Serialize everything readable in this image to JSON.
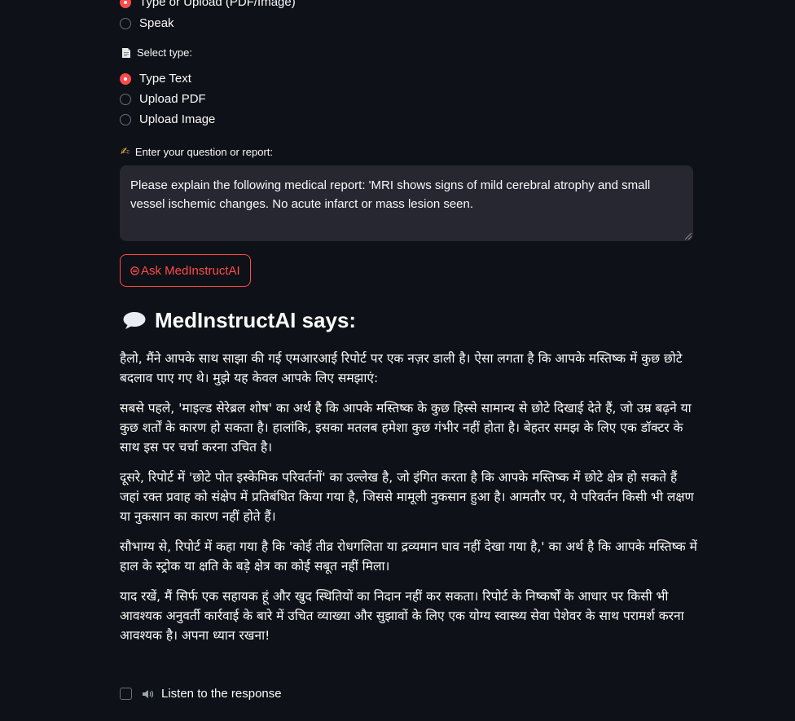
{
  "input_mode": {
    "options": [
      {
        "label": "Type or Upload (PDF/Image)",
        "selected": true
      },
      {
        "label": "Speak",
        "selected": false
      }
    ]
  },
  "select_type": {
    "icon": "document-icon",
    "label": "Select type:",
    "options": [
      {
        "label": "Type Text",
        "selected": true
      },
      {
        "label": "Upload PDF",
        "selected": false
      },
      {
        "label": "Upload Image",
        "selected": false
      }
    ]
  },
  "question": {
    "icon": "writing-hand-icon",
    "label": "Enter your question or report:",
    "value": "Please explain the following medical report: 'MRI shows signs of mild cerebral atrophy and small vessel ischemic changes. No acute infarct or mass lesion seen."
  },
  "ask_button": {
    "icon": "stethoscope-icon",
    "label": "Ask MedInstructAI"
  },
  "response": {
    "icon": "speech-bubble-icon",
    "heading": "MedInstructAI says:",
    "paragraphs": [
      "हैलो, मैंने आपके साथ साझा की गई एमआरआई रिपोर्ट पर एक नज़र डाली है। ऐसा लगता है कि आपके मस्तिष्क में कुछ छोटे बदलाव पाए गए थे। मुझे यह केवल आपके लिए समझाएं:",
      "सबसे पहले, 'माइल्ड सेरेब्रल शोष' का अर्थ है कि आपके मस्तिष्क के कुछ हिस्से सामान्य से छोटे दिखाई देते हैं, जो उम्र बढ़ने या कुछ शर्तों के कारण हो सकता है। हालांकि, इसका मतलब हमेशा कुछ गंभीर नहीं होता है। बेहतर समझ के लिए एक डॉक्टर के साथ इस पर चर्चा करना उचित है।",
      "दूसरे, रिपोर्ट में 'छोटे पोत इस्केमिक परिवर्तनों' का उल्लेख है, जो इंगित करता है कि आपके मस्तिष्क में छोटे क्षेत्र हो सकते हैं जहां रक्त प्रवाह को संक्षेप में प्रतिबंधित किया गया है, जिससे मामूली नुकसान हुआ है। आमतौर पर, ये परिवर्तन किसी भी लक्षण या नुकसान का कारण नहीं होते हैं।",
      "सौभाग्य से, रिपोर्ट में कहा गया है कि 'कोई तीव्र रोधगलिता या द्रव्यमान घाव नहीं देखा गया है,' का अर्थ है कि आपके मस्तिष्क में हाल के स्ट्रोक या क्षति के बड़े क्षेत्र का कोई सबूत नहीं मिला।",
      "याद रखें, मैं सिर्फ एक सहायक हूं और खुद स्थितियों का निदान नहीं कर सकता। रिपोर्ट के निष्कर्षों के आधार पर किसी भी आवश्यक अनुवर्ती कार्रवाई के बारे में उचित व्याख्या और सुझावों के लिए एक योग्य स्वास्थ्य सेवा पेशेवर के साथ परामर्श करना आवश्यक है। अपना ध्यान रखना!"
    ]
  },
  "listen": {
    "icon": "speaker-icon",
    "label": "Listen to the response",
    "checked": false
  },
  "colors": {
    "background": "#0e1117",
    "accent": "#ff4b4b",
    "input_bg": "#262730"
  }
}
